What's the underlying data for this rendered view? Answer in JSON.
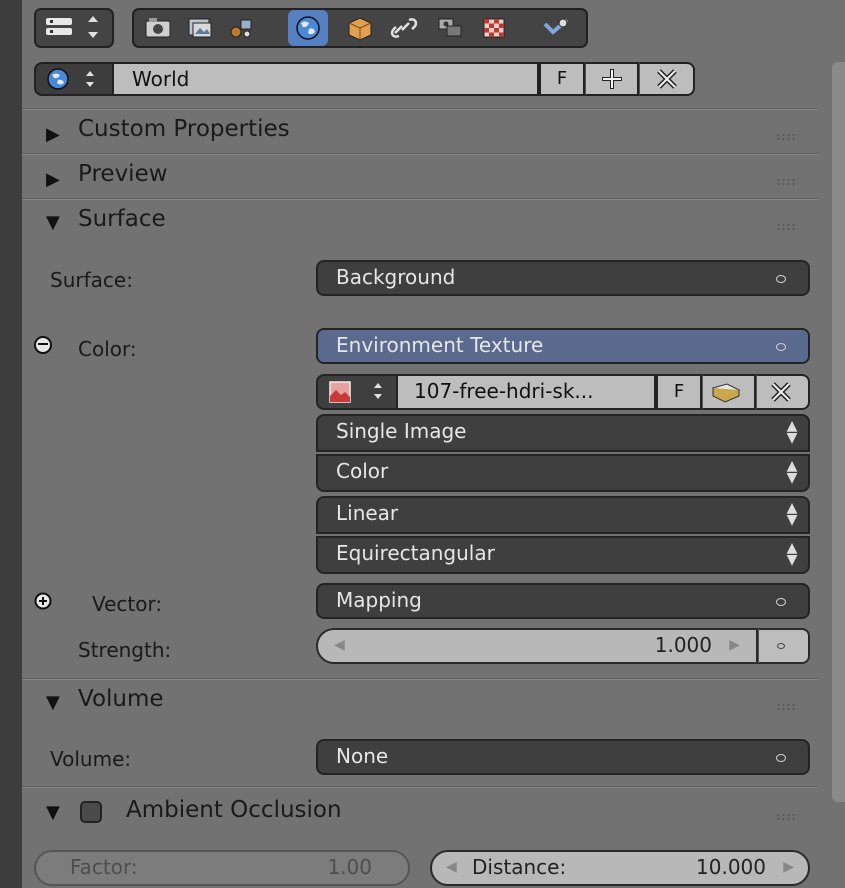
{
  "toolbar": {
    "editor_icon": "properties-editor-icon",
    "context_icons": [
      "render-camera-icon",
      "render-layers-icon",
      "scene-icon",
      "world-icon",
      "object-icon",
      "constraints-link-icon",
      "modifiers-icon",
      "texture-checker-icon",
      "physics-icon"
    ],
    "active": "world-icon"
  },
  "datablock": {
    "icon": "world-icon",
    "name": "World",
    "fake_user": "F"
  },
  "panels": {
    "custom_properties": "Custom Properties",
    "preview": "Preview",
    "surface": "Surface",
    "volume": "Volume",
    "ambient_occlusion": "Ambient Occlusion"
  },
  "surface": {
    "surface_label": "Surface:",
    "surface_value": "Background",
    "color_label": "Color:",
    "color_value": "Environment Texture",
    "image_name": "107-free-hdri-sk...",
    "image_fake_user": "F",
    "source": "Single Image",
    "color_space": "Color",
    "interpolation": "Linear",
    "projection": "Equirectangular",
    "vector_label": "Vector:",
    "vector_value": "Mapping",
    "strength_label": "Strength:",
    "strength_value": "1.000"
  },
  "volume": {
    "volume_label": "Volume:",
    "volume_value": "None"
  },
  "ao": {
    "enabled": false,
    "factor_label": "Factor:",
    "factor_value": "1.00",
    "distance_label": "Distance:",
    "distance_value": "10.000"
  }
}
